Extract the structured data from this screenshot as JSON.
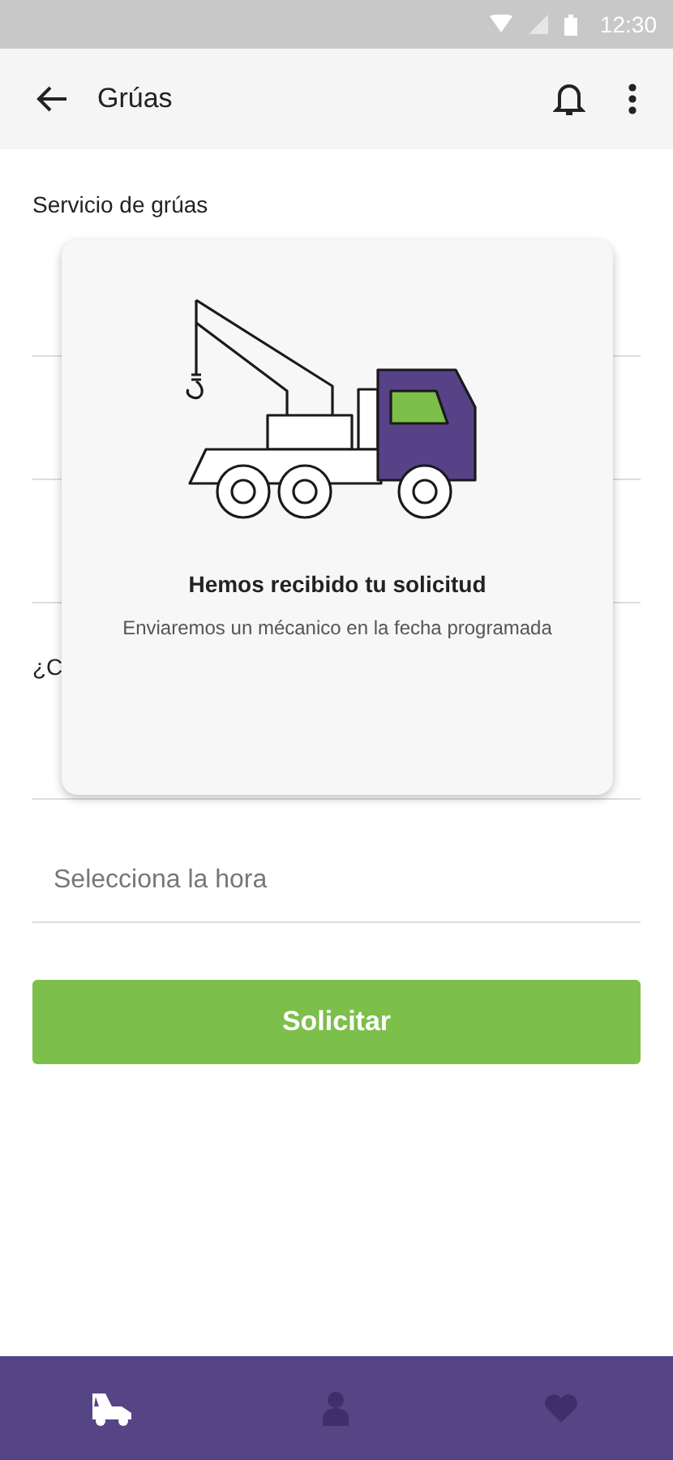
{
  "status_bar": {
    "time": "12:30"
  },
  "app_bar": {
    "title": "Grúas"
  },
  "form": {
    "section_label": "Servicio de grúas",
    "fields": [
      {
        "kind": "input"
      },
      {
        "kind": "input"
      },
      {
        "kind": "input"
      }
    ],
    "question_label": "¿C",
    "fields_2": [
      {
        "kind": "input"
      },
      {
        "kind": "input",
        "placeholder": "Selecciona la hora"
      }
    ],
    "submit": "Solicitar"
  },
  "dialog": {
    "title": "Hemos recibido tu solicitud",
    "message": "Enviaremos un mécanico en la fecha programada"
  },
  "bottom_nav": [
    {
      "kind": "tow",
      "selected": true
    },
    {
      "kind": "person",
      "selected": false
    },
    {
      "kind": "heart",
      "selected": false
    }
  ]
}
